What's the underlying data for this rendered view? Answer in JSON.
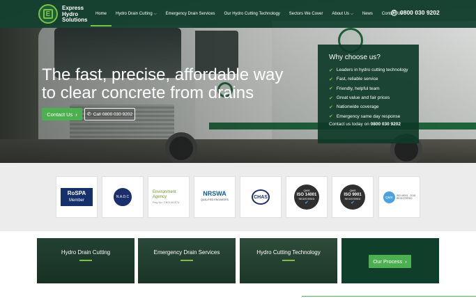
{
  "brand": {
    "line1": "Express",
    "line2": "Hydro",
    "line3": "Solutions",
    "logo_letter": "E"
  },
  "nav": {
    "items": [
      {
        "label": "Home",
        "active": true
      },
      {
        "label": "Hydro Drain Cutting",
        "has_dropdown": true
      },
      {
        "label": "Emergency Drain Services"
      },
      {
        "label": "Our Hydro Cutting Technology"
      },
      {
        "label": "Sectors We Cover"
      },
      {
        "label": "About Us",
        "has_dropdown": true
      },
      {
        "label": "News"
      },
      {
        "label": "Contact Us"
      }
    ],
    "phone": "0800 030 9202",
    "phone_icon": "phone-icon"
  },
  "hero": {
    "headline_line1": "The fast, precise, affordable way",
    "headline_line2": "to clear concrete from drains",
    "contact_button": "Contact Us",
    "call_button": "Call 0800 030 9202"
  },
  "why": {
    "title": "Why choose us?",
    "items": [
      "Leaders in hydro cutting technology",
      "Fast, reliable service",
      "Friendly, helpful team",
      "Great value and fair prices",
      "Nationwide coverage",
      "Emergency same day response"
    ],
    "contact_prefix": "Contact us today on",
    "contact_phone": "0800 030 9202"
  },
  "accreditations": {
    "rospa": {
      "name": "RoSPA",
      "sub": "Member"
    },
    "nadc": {
      "name": "N.A.D.C"
    },
    "ea": {
      "line1": "Environment",
      "line2": "Agency",
      "reg": "Reg No: CBDU60174"
    },
    "nrswa": {
      "name": "NRSWA",
      "sub": "QUALIFIED ENGINEERS"
    },
    "chas": {
      "name": "CHAS"
    },
    "iso14001": {
      "qms": "QMS",
      "num": "ISO 14001",
      "reg": "REGISTERED"
    },
    "iso9001": {
      "qms": "QMS",
      "num": "ISO 9001",
      "reg": "REGISTERED"
    },
    "iso45001": {
      "qms": "QMS",
      "line1": "ISO 45001 : 2018",
      "line2": "REGISTERED"
    }
  },
  "tiles": [
    {
      "label": "Hydro Drain Cutting"
    },
    {
      "label": "Emergency Drain Services"
    },
    {
      "label": "Hydro Cutting Technology"
    }
  ],
  "process_button": "Our Process",
  "colors": {
    "primary_green": "#4caf50",
    "dark_green": "#0f3f2a",
    "accent_green": "#7cc142"
  }
}
